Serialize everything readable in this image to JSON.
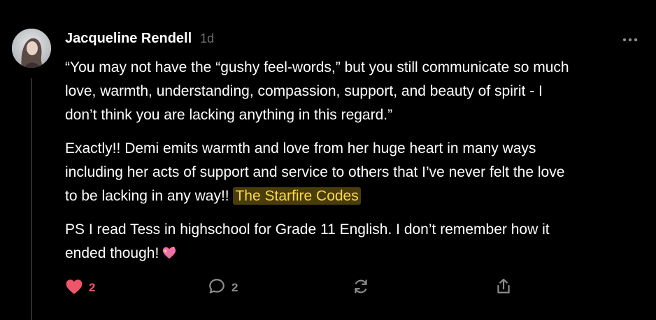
{
  "comment": {
    "author": "Jacqueline Rendell",
    "age": "1d",
    "paragraphs": [
      {
        "lines": [
          "“You may not have the “gushy feel-words,” but you still communicate so much",
          "love, warmth, understanding, compassion, support, and beauty of spirit - I",
          "don’t think you are lacking anything in this regard.”"
        ]
      },
      {
        "lines": [
          "Exactly!! Demi emits warmth and love from her huge heart in many ways",
          "including her acts of support and service to others that I’ve never felt the love",
          "to be lacking in any way!!"
        ],
        "mention": "The Starfire Codes"
      },
      {
        "lines": [
          "PS I read Tess in highschool for Grade 11 English. I don’t remember how it",
          "ended though!"
        ],
        "emoji": "sparkling-heart-icon"
      }
    ]
  },
  "actions": {
    "like_count": "2",
    "reply_count": "2",
    "like_icon": "heart-icon",
    "reply_icon": "comment-icon",
    "restack_icon": "restack-icon",
    "share_icon": "share-icon"
  },
  "colors": {
    "background": "#000000",
    "text": "#ffffff",
    "muted": "#6f6f6f",
    "like": "#f0566a",
    "mention_bg": "#4a3d0c",
    "mention_text": "#ffd945",
    "icon": "#8e8e8e"
  }
}
